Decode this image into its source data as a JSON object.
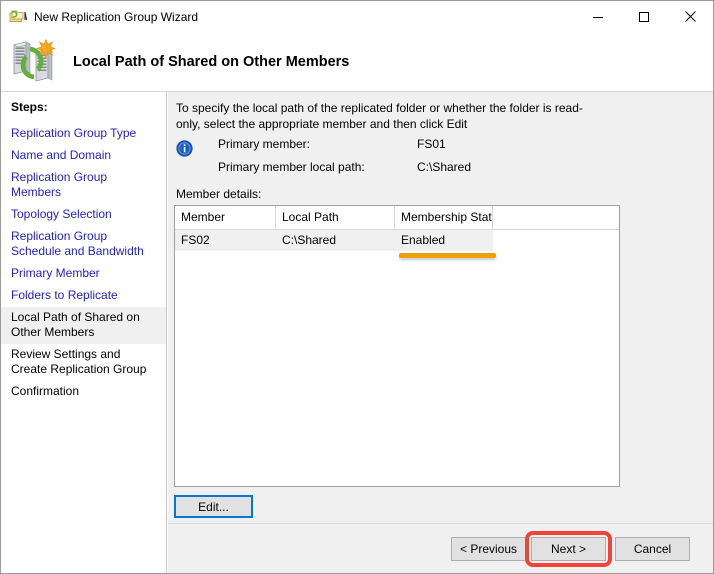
{
  "window": {
    "title": "New Replication Group Wizard",
    "app_icon": "replication-folder-icon",
    "controls": {
      "minimize": "minimize-icon",
      "maximize": "maximize-icon",
      "close": "close-icon"
    }
  },
  "header": {
    "icon": "dfs-replication-servers-icon",
    "title": "Local Path of Shared on Other Members"
  },
  "sidebar": {
    "label": "Steps:",
    "items": [
      {
        "label": "Replication Group Type",
        "state": "visited"
      },
      {
        "label": "Name and Domain",
        "state": "visited"
      },
      {
        "label": "Replication Group Members",
        "state": "visited"
      },
      {
        "label": "Topology Selection",
        "state": "visited"
      },
      {
        "label": "Replication Group Schedule and Bandwidth",
        "state": "visited"
      },
      {
        "label": "Primary Member",
        "state": "visited"
      },
      {
        "label": "Folders to Replicate",
        "state": "visited"
      },
      {
        "label": "Local Path of Shared on Other Members",
        "state": "current"
      },
      {
        "label": "Review Settings and Create Replication Group",
        "state": "pending"
      },
      {
        "label": "Confirmation",
        "state": "pending"
      }
    ]
  },
  "content": {
    "instruction": "To specify the local path of the replicated folder or whether the folder is read-only, select the appropriate member and then click Edit",
    "info_icon": "information-icon",
    "info_rows": [
      {
        "label": "Primary member:",
        "value": "FS01"
      },
      {
        "label": "Primary member local path:",
        "value": "C:\\Shared"
      }
    ],
    "member_details_label": "Member details:",
    "grid": {
      "columns": [
        "Member",
        "Local Path",
        "Membership Stat..."
      ],
      "rows": [
        {
          "member": "FS02",
          "local_path": "C:\\Shared",
          "membership_status": "Enabled"
        }
      ]
    },
    "edit_button": "Edit..."
  },
  "footer": {
    "previous": "< Previous",
    "next": "Next >",
    "cancel": "Cancel"
  },
  "annotations": {
    "orange_underline_color": "#f0a00a",
    "red_highlight_color": "#f04438",
    "focus_border_color": "#0078d7"
  }
}
